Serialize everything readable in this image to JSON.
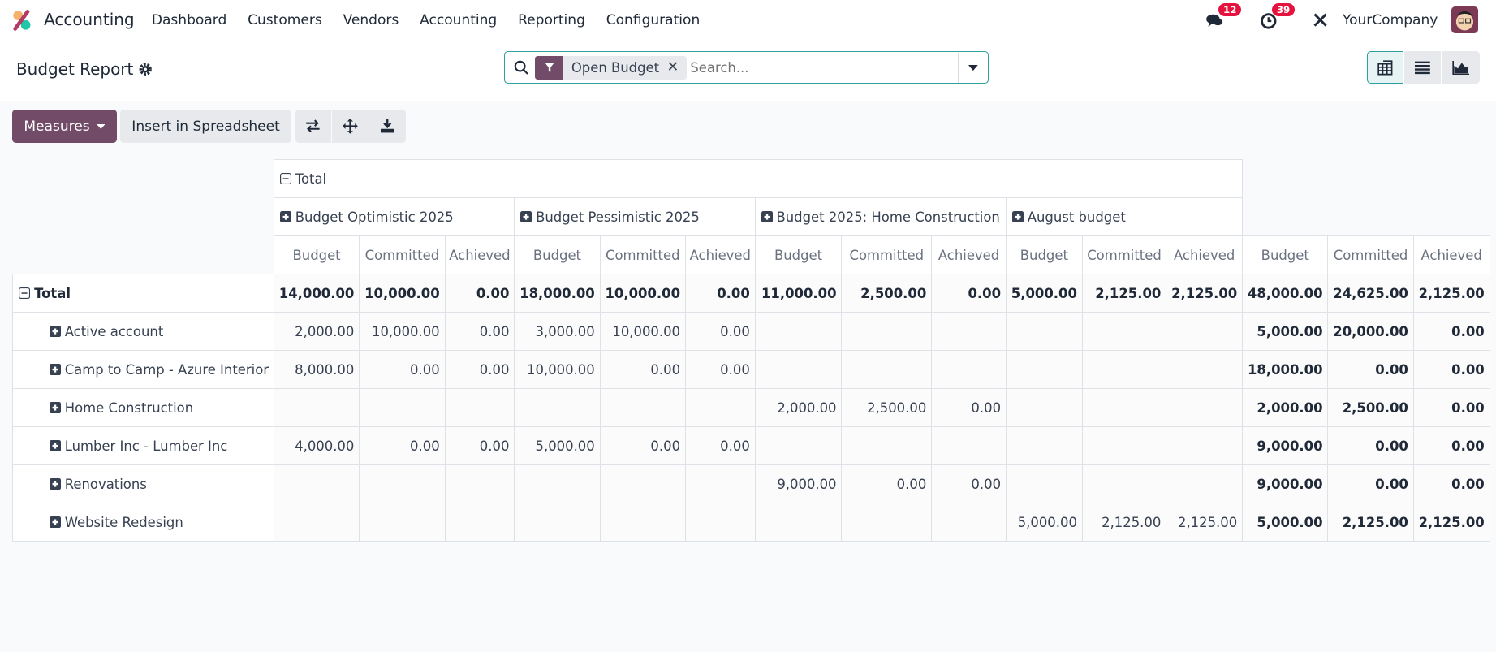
{
  "app": {
    "name": "Accounting",
    "nav": [
      "Dashboard",
      "Customers",
      "Vendors",
      "Accounting",
      "Reporting",
      "Configuration"
    ]
  },
  "systray": {
    "messages_count": "12",
    "activities_count": "39",
    "company": "YourCompany"
  },
  "control": {
    "title": "Budget Report",
    "facet": "Open Budget",
    "search_placeholder": "Search..."
  },
  "buttons": {
    "measures": "Measures",
    "insert": "Insert in Spreadsheet"
  },
  "pivot": {
    "col_root": "Total",
    "groups": [
      "Budget Optimistic 2025",
      "Budget Pessimistic 2025",
      "Budget 2025: Home Construction",
      "August budget"
    ],
    "measures": [
      "Budget",
      "Committed",
      "Achieved"
    ],
    "rows": [
      {
        "label": "Total",
        "values": [
          "14,000.00",
          "10,000.00",
          "0.00",
          "18,000.00",
          "10,000.00",
          "0.00",
          "11,000.00",
          "2,500.00",
          "0.00",
          "5,000.00",
          "2,125.00",
          "2,125.00",
          "48,000.00",
          "24,625.00",
          "2,125.00"
        ]
      },
      {
        "label": "Active account",
        "values": [
          "2,000.00",
          "10,000.00",
          "0.00",
          "3,000.00",
          "10,000.00",
          "0.00",
          "",
          "",
          "",
          "",
          "",
          "",
          "5,000.00",
          "20,000.00",
          "0.00"
        ]
      },
      {
        "label": "Camp to Camp - Azure Interior",
        "values": [
          "8,000.00",
          "0.00",
          "0.00",
          "10,000.00",
          "0.00",
          "0.00",
          "",
          "",
          "",
          "",
          "",
          "",
          "18,000.00",
          "0.00",
          "0.00"
        ]
      },
      {
        "label": "Home Construction",
        "values": [
          "",
          "",
          "",
          "",
          "",
          "",
          "2,000.00",
          "2,500.00",
          "0.00",
          "",
          "",
          "",
          "2,000.00",
          "2,500.00",
          "0.00"
        ]
      },
      {
        "label": "Lumber Inc - Lumber Inc",
        "values": [
          "4,000.00",
          "0.00",
          "0.00",
          "5,000.00",
          "0.00",
          "0.00",
          "",
          "",
          "",
          "",
          "",
          "",
          "9,000.00",
          "0.00",
          "0.00"
        ]
      },
      {
        "label": "Renovations",
        "values": [
          "",
          "",
          "",
          "",
          "",
          "",
          "9,000.00",
          "0.00",
          "0.00",
          "",
          "",
          "",
          "9,000.00",
          "0.00",
          "0.00"
        ]
      },
      {
        "label": "Website Redesign",
        "values": [
          "",
          "",
          "",
          "",
          "",
          "",
          "",
          "",
          "",
          "5,000.00",
          "2,125.00",
          "2,125.00",
          "5,000.00",
          "2,125.00",
          "2,125.00"
        ]
      }
    ]
  },
  "colors": {
    "primary": "#714b67",
    "accent": "#2f9e9e",
    "badge": "#e5123d"
  }
}
